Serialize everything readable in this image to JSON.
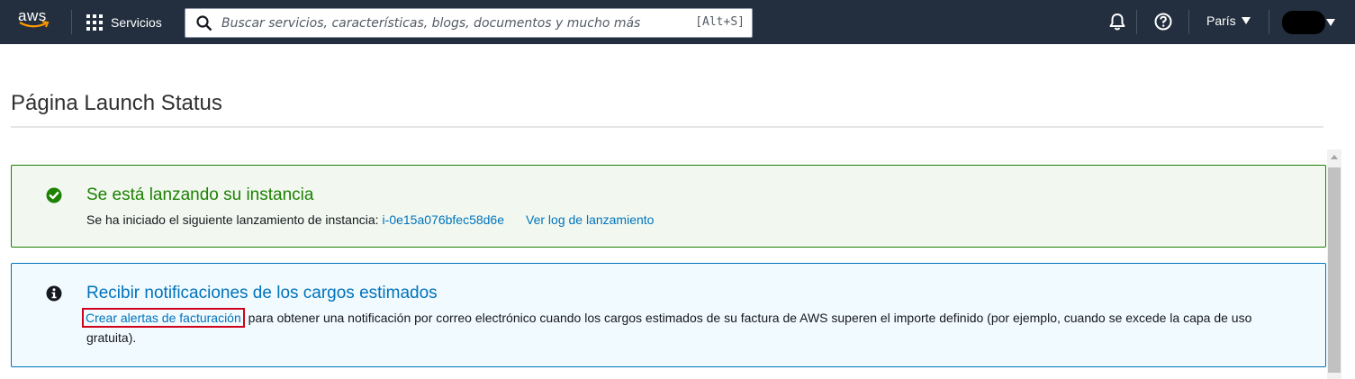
{
  "nav": {
    "logo_text": "aws",
    "services_label": "Servicios",
    "search_placeholder": "Buscar servicios, características, blogs, documentos y mucho más",
    "search_shortcut": "[Alt+S]",
    "region_label": "París",
    "icons": {
      "grid": "grid-icon",
      "search": "search-icon",
      "bell": "bell-icon",
      "help": "help-icon"
    },
    "colors": {
      "bar": "#232f3e",
      "smile": "#ff9900"
    }
  },
  "page": {
    "title": "Página Launch Status"
  },
  "success_alert": {
    "icon": "check-circle-icon",
    "heading": "Se está lanzando su instancia",
    "body_text": "Se ha iniciado el siguiente lanzamiento de instancia:",
    "instance_id": "i-0e15a076bfec58d6e",
    "log_link": "Ver log de lanzamiento",
    "color": "#1d8102"
  },
  "info_alert": {
    "icon": "info-circle-icon",
    "heading": "Recibir notificaciones de los cargos estimados",
    "link_text": "Crear alertas de facturación",
    "body_text": "para obtener una notificación por correo electrónico cuando los cargos estimados de su factura de AWS superen el importe definido (por ejemplo, cuando se excede la capa de uso gratuita).",
    "color": "#0073bb",
    "highlight_color": "#d0021b"
  }
}
